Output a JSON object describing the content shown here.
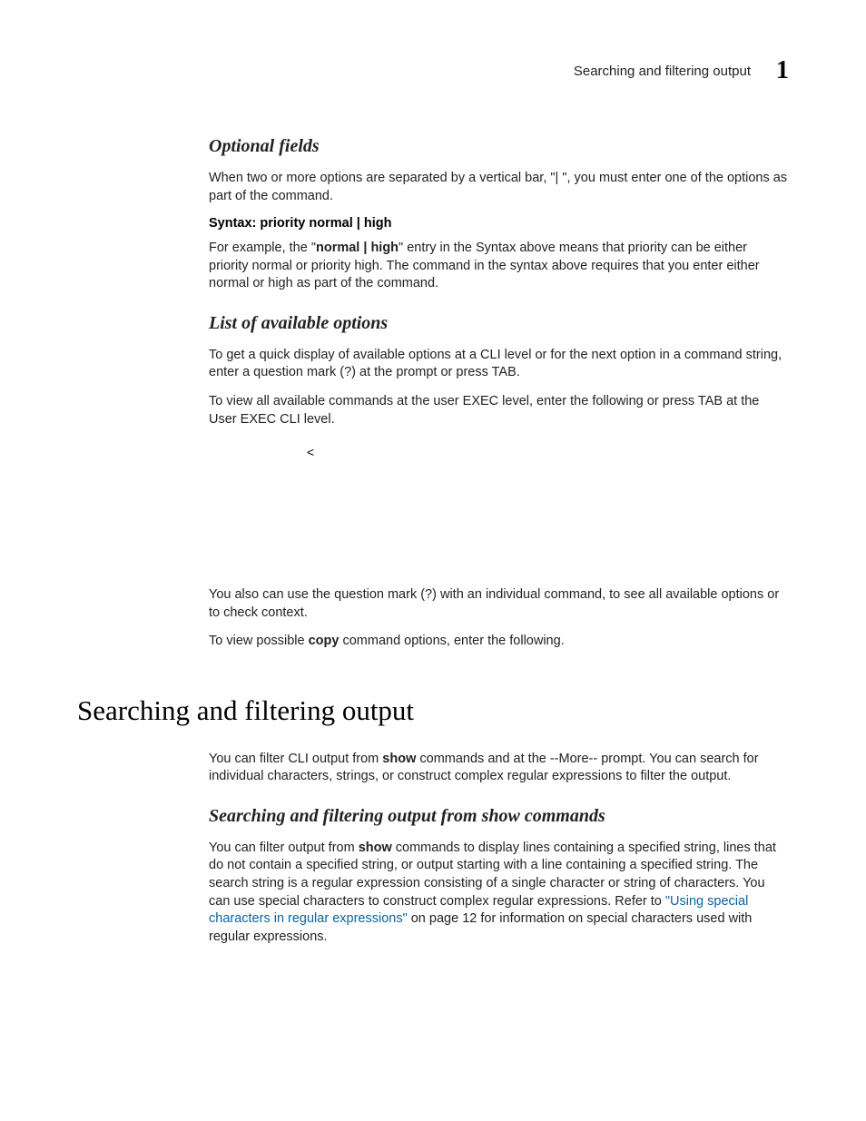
{
  "header": {
    "running_head": "Searching and filtering output",
    "chapter_number": "1"
  },
  "section_optional": {
    "heading": "Optional fields",
    "intro": "When two or more options are separated by a vertical bar, \"| \", you must enter one of the options as part of the command.",
    "syntax_label": "Syntax:  priority normal | high",
    "example_prefix": "For example, the \"",
    "example_bold": "normal | high",
    "example_suffix": "\" entry in the Syntax above means that priority can be either priority normal or priority high. The command in the syntax above requires that you enter either normal or high as part of the command."
  },
  "section_list": {
    "heading": "List of available options",
    "p1": "To get a quick display of available options at a CLI level or for the next option in a command string, enter a question mark (?) at the prompt or press TAB.",
    "p2": "To view all available commands at the user EXEC level, enter the following or press TAB at the User EXEC CLI level.",
    "angle": "<",
    "p3": "You also can use the question mark (?) with an individual command, to see all available options or to check context.",
    "p4_prefix": "To view possible ",
    "p4_bold": "copy",
    "p4_suffix": " command options, enter the following."
  },
  "section_search": {
    "heading": "Searching and filtering output",
    "intro_prefix": "You can filter CLI output from ",
    "intro_bold": "show",
    "intro_suffix": " commands and at the --More-- prompt.  You can search for individual characters, strings, or construct complex regular expressions to filter the output.",
    "sub_heading": "Searching and filtering output from show commands",
    "p_prefix": "You can filter output from ",
    "p_bold": "show",
    "p_mid": " commands to display lines containing a specified string, lines that do not contain a specified string, or output starting with a line containing a specified string. The search string is a regular expression consisting of a single character or string of characters. You can use special characters to construct complex regular expressions. Refer to ",
    "p_link": "\"Using special characters in regular expressions\"",
    "p_end": " on page 12 for information on special characters used with regular expressions."
  }
}
